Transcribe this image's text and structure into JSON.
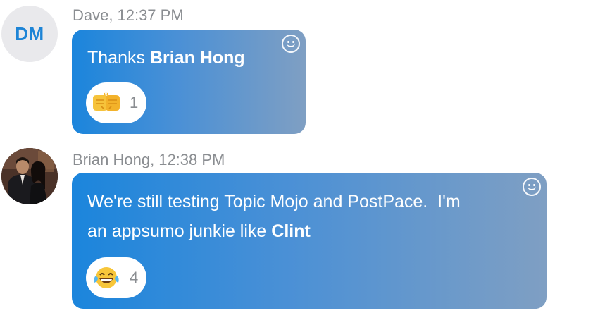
{
  "messages": [
    {
      "avatar_initials": "DM",
      "author": "Dave",
      "time": "12:37 PM",
      "text_prefix": "Thanks ",
      "mention": "Brian Hong",
      "reaction": {
        "emoji": "fist-bump",
        "count": "1"
      }
    },
    {
      "author": "Brian Hong",
      "time": "12:38 PM",
      "line1": "We're still testing Topic Mojo and PostPace.  I'm",
      "line2_prefix": "an appsumo junkie like ",
      "mention": "Clint",
      "reaction": {
        "emoji": "tears-of-joy",
        "count": "4"
      }
    }
  ],
  "colors": {
    "bubble_start": "#1b85dc",
    "bubble_end": "#7f9fc3",
    "initials": "#1d84d6",
    "meta_text": "#8a8d91"
  }
}
